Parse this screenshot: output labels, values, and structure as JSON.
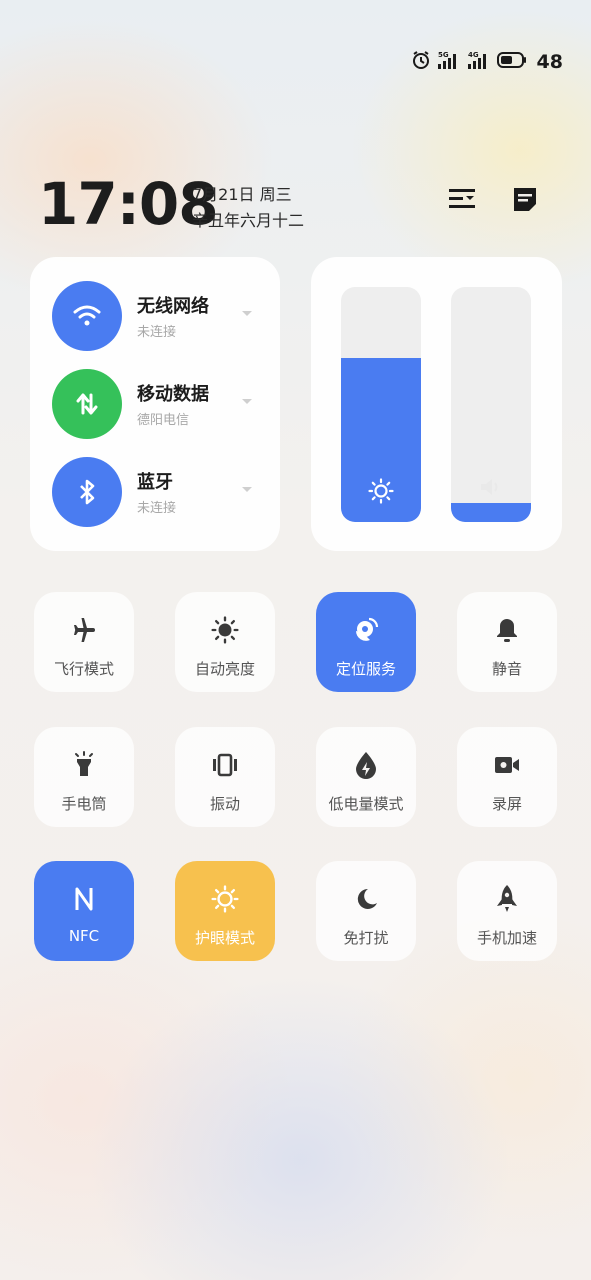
{
  "status_bar": {
    "net1": "5G",
    "net2": "4G",
    "battery": "48"
  },
  "header": {
    "time": "17:08",
    "date": "7月21日 周三",
    "lunar_date": "辛丑年六月十二"
  },
  "connectivity": [
    {
      "title": "无线网络",
      "subtitle": "未连接",
      "icon": "wifi-icon",
      "color": "#4a7cf1"
    },
    {
      "title": "移动数据",
      "subtitle": "德阳电信",
      "icon": "mobile-data-icon",
      "color": "#35c15a"
    },
    {
      "title": "蓝牙",
      "subtitle": "未连接",
      "icon": "bluetooth-icon",
      "color": "#4a7cf1"
    }
  ],
  "sliders": {
    "brightness_fraction": 0.7,
    "volume_fraction": 0.08,
    "accent": "#4a7cf1"
  },
  "tiles": [
    {
      "label": "飞行模式",
      "icon": "airplane-icon",
      "state": "off"
    },
    {
      "label": "自动亮度",
      "icon": "sun-icon",
      "state": "off"
    },
    {
      "label": "定位服务",
      "icon": "location-icon",
      "state": "on"
    },
    {
      "label": "静音",
      "icon": "bell-icon",
      "state": "off"
    },
    {
      "label": "手电筒",
      "icon": "flashlight-icon",
      "state": "off"
    },
    {
      "label": "振动",
      "icon": "vibrate-icon",
      "state": "off"
    },
    {
      "label": "低电量模式",
      "icon": "battery-saver-icon",
      "state": "off"
    },
    {
      "label": "录屏",
      "icon": "screen-record-icon",
      "state": "off"
    },
    {
      "label": "NFC",
      "icon": "nfc-icon",
      "state": "on"
    },
    {
      "label": "护眼模式",
      "icon": "eye-care-icon",
      "state": "on-amber"
    },
    {
      "label": "免打扰",
      "icon": "moon-icon",
      "state": "off"
    },
    {
      "label": "手机加速",
      "icon": "rocket-icon",
      "state": "off"
    }
  ]
}
